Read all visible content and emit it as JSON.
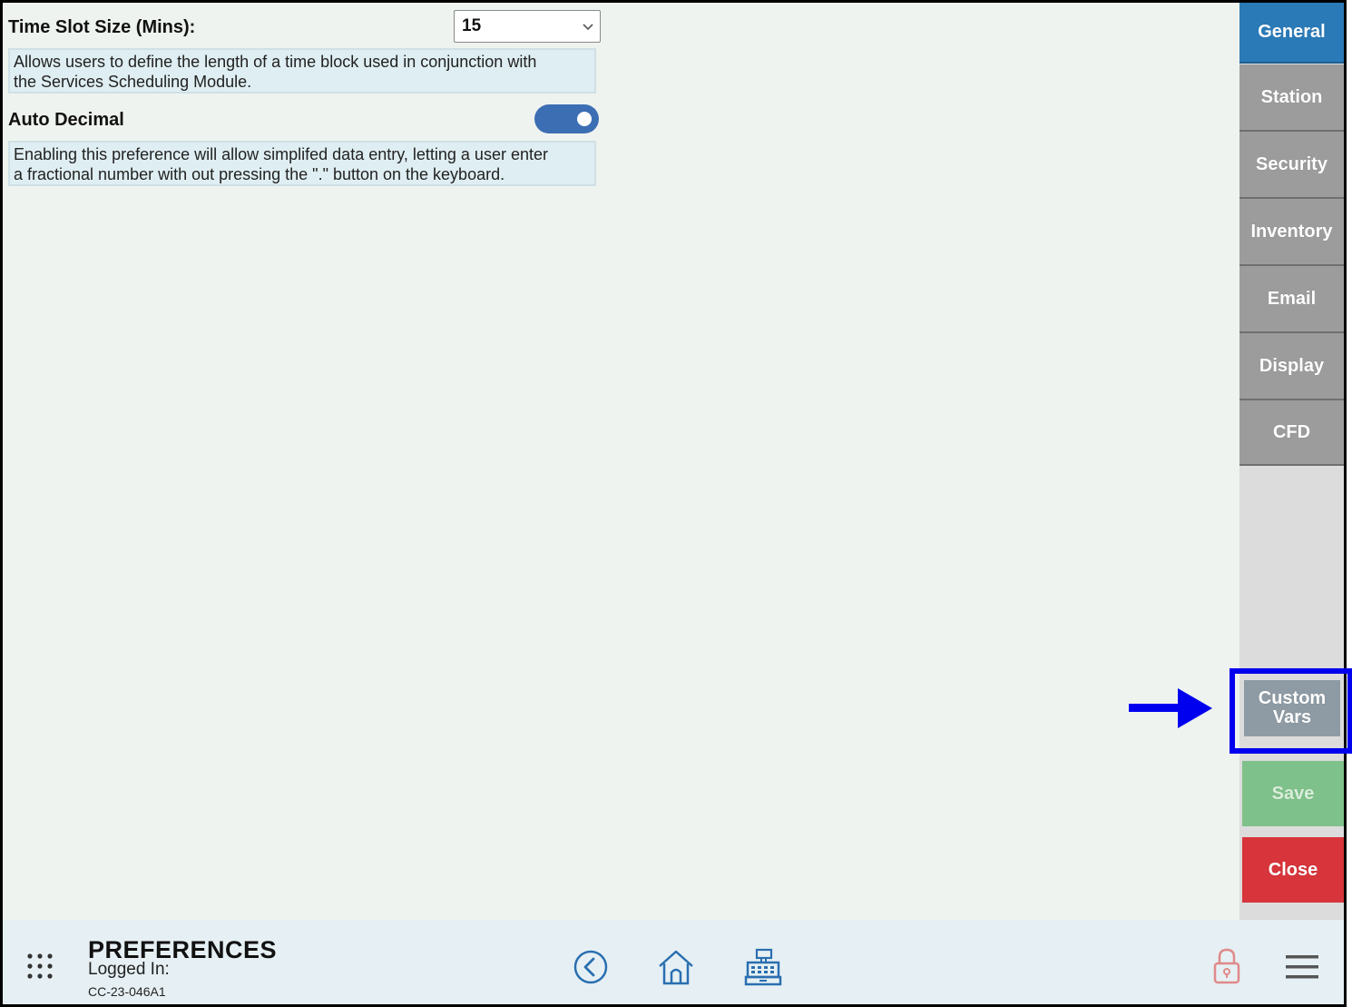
{
  "preferences": {
    "time_slot": {
      "label": "Time Slot Size (Mins):",
      "value": "15",
      "description_line1": "Allows users to define the length of a time block used in conjunction with",
      "description_line2": "the Services Scheduling Module."
    },
    "auto_decimal": {
      "label": "Auto Decimal",
      "enabled": true,
      "description_line1": "Enabling this preference will allow simplifed data entry, letting a user enter",
      "description_line2": "a fractional number with out pressing the \".\" button on the keyboard."
    }
  },
  "sidebar": {
    "tabs": [
      "General",
      "Station",
      "Security",
      "Inventory",
      "Email",
      "Display",
      "CFD"
    ],
    "active_tab": "General",
    "custom_vars_line1": "Custom",
    "custom_vars_line2": "Vars",
    "save_label": "Save",
    "close_label": "Close"
  },
  "footer": {
    "title": "PREFERENCES",
    "logged_in_label": "Logged In:",
    "station_id": "CC-23-046A1",
    "icons": [
      "apps-grid-icon",
      "back-circle-icon",
      "home-icon",
      "cash-register-icon",
      "lock-icon",
      "hamburger-menu-icon"
    ]
  },
  "colors": {
    "active_tab": "#2a7ab8",
    "inactive_tab": "#9c9c9c",
    "save": "#7fc18a",
    "close": "#d7343b",
    "highlight": "#0000ee"
  }
}
